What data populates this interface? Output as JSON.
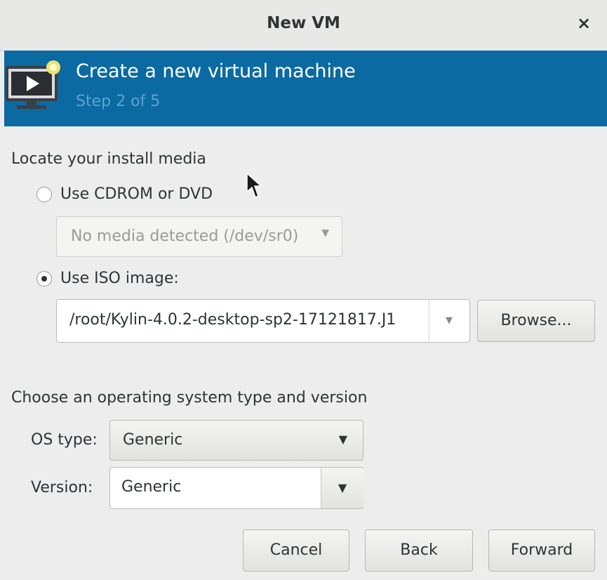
{
  "window": {
    "title": "New VM",
    "close_glyph": "×"
  },
  "header": {
    "title": "Create a new virtual machine",
    "step": "Step 2 of 5",
    "icon": "virtual-machine-icon",
    "bg_color": "#0b6aa2"
  },
  "install_media": {
    "heading": "Locate your install media",
    "cdrom": {
      "label": "Use CDROM or DVD",
      "selected": false,
      "device_combo": {
        "value": "No media detected (/dev/sr0)",
        "disabled": true,
        "arrow": "▼"
      }
    },
    "iso": {
      "label": "Use ISO image:",
      "selected": true,
      "path": "/root/Kylin-4.0.2-desktop-sp2-17121817.J1",
      "arrow": "▼",
      "browse_label": "Browse..."
    }
  },
  "os": {
    "heading": "Choose an operating system type and version",
    "type_label": "OS type:",
    "type_value": "Generic",
    "version_label": "Version:",
    "version_value": "Generic",
    "arrow": "▼"
  },
  "footer": {
    "cancel_label": "Cancel",
    "back_label": "Back",
    "forward_label": "Forward"
  }
}
